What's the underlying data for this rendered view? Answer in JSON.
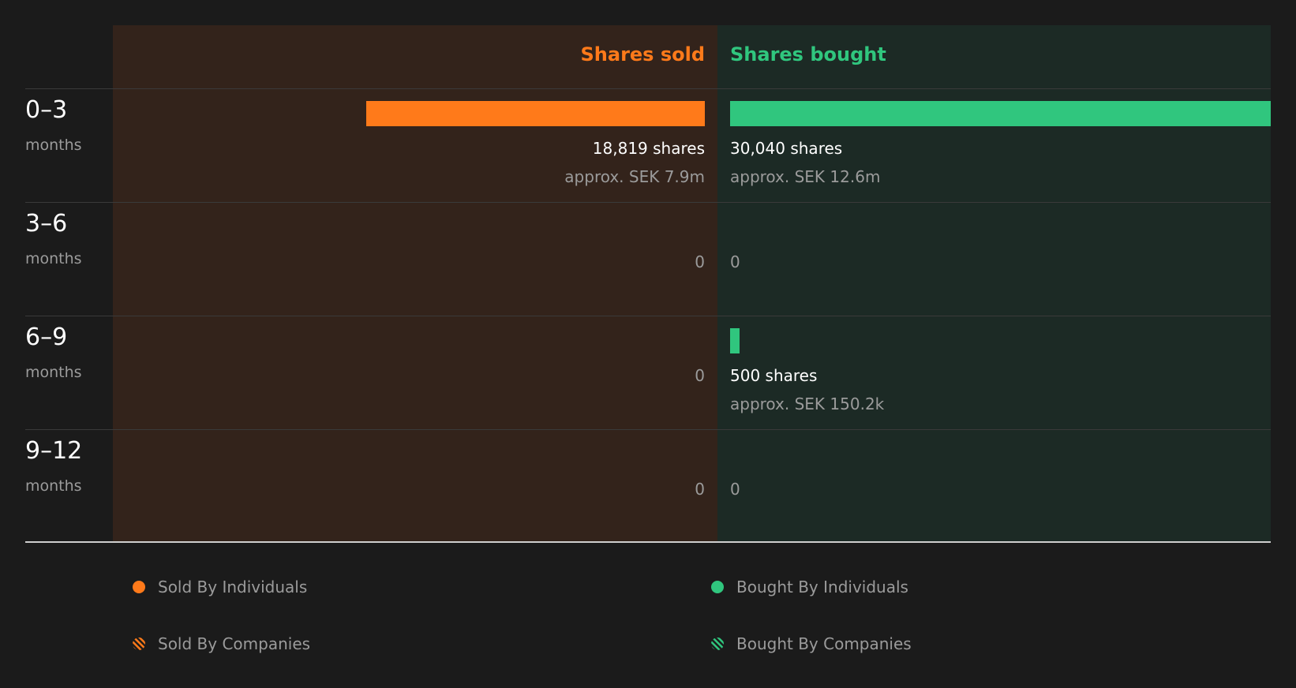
{
  "colors": {
    "sold": "#ff7a1a",
    "bought": "#30c67e",
    "sold_panel": "#33231b",
    "bought_panel": "#1c2a25",
    "background": "#1b1b1b"
  },
  "chart_data": {
    "type": "bar",
    "orientation": "horizontal-diverging",
    "headers": {
      "sold": "Shares sold",
      "bought": "Shares bought"
    },
    "categories": [
      {
        "label": "0–3",
        "unit": "months"
      },
      {
        "label": "3–6",
        "unit": "months"
      },
      {
        "label": "6–9",
        "unit": "months"
      },
      {
        "label": "9–12",
        "unit": "months"
      }
    ],
    "series": [
      {
        "name": "Shares sold",
        "values": [
          18819,
          0,
          0,
          0
        ],
        "shares_labels": [
          "18,819 shares",
          "0",
          "0",
          "0"
        ],
        "value_labels": [
          "approx. SEK 7.9m",
          "",
          "",
          ""
        ]
      },
      {
        "name": "Shares bought",
        "values": [
          30040,
          0,
          500,
          0
        ],
        "shares_labels": [
          "30,040 shares",
          "0",
          "500 shares",
          "0"
        ],
        "value_labels": [
          "approx. SEK 12.6m",
          "",
          "approx. SEK 150.2k",
          ""
        ]
      }
    ],
    "xlim": [
      0,
      30040
    ],
    "legend": [
      {
        "label": "Sold By Individuals",
        "pattern": "solid",
        "series": "sold"
      },
      {
        "label": "Bought By Individuals",
        "pattern": "solid",
        "series": "bought"
      },
      {
        "label": "Sold By Companies",
        "pattern": "striped",
        "series": "sold"
      },
      {
        "label": "Bought By Companies",
        "pattern": "striped",
        "series": "bought"
      }
    ],
    "legend_position": "bottom"
  }
}
